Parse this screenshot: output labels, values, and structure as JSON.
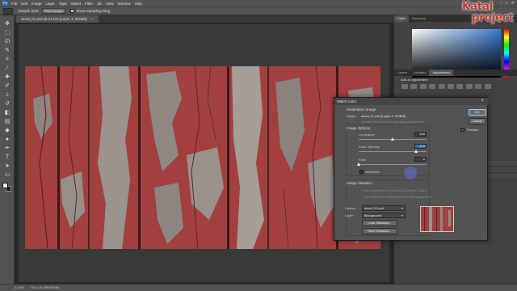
{
  "menubar": {
    "app_icon": "Ps",
    "items": [
      "File",
      "Edit",
      "Image",
      "Layer",
      "Type",
      "Select",
      "Filter",
      "3D",
      "View",
      "Window",
      "Help"
    ],
    "window_buttons": [
      "–",
      "□",
      "✕"
    ]
  },
  "options_bar": {
    "sample_size_label": "Sample Size:",
    "sample_size_value": "Point Sample",
    "show_sampling_ring": "Show Sampling Ring"
  },
  "document": {
    "tab_label": "wood_01.psd @ 21.5% (Layer 4, RGB/8)",
    "tab_close": "×"
  },
  "status_bar": {
    "zoom": "21.5%",
    "doc_info": "Doc: 15.2M/195.6M"
  },
  "color_panel": {
    "tabs": [
      "Color",
      "Swatches"
    ],
    "active_tab": "Color"
  },
  "adjustments_panel": {
    "tabs": [
      "Layers",
      "Libraries",
      "Adjustments"
    ],
    "active_tab": "Adjustments",
    "add_label": "Add an adjustment"
  },
  "match_color": {
    "title": "Match Color",
    "ok_label": "OK",
    "cancel_label": "Cancel",
    "preview_label": "Preview",
    "preview_checked": true,
    "destination_image_label": "Destination Image",
    "target_label": "Target:",
    "target_value": "wood_01.psd (Layer 4, RGB/8)",
    "ignore_selection_label": "Ignore Selection when Applying Adjustment",
    "image_options_label": "Image Options",
    "luminance_label": "Luminance",
    "luminance_value": "100",
    "luminance_level": 100,
    "luminance_max": 200,
    "color_intensity_label": "Color Intensity",
    "color_intensity_value": "170",
    "color_intensity_level": 170,
    "color_intensity_max": 200,
    "fade_label": "Fade",
    "fade_value": "0",
    "fade_level": 0,
    "fade_max": 100,
    "neutralize_label": "Neutralize",
    "image_statistics_label": "Image Statistics",
    "use_selection_source_label": "Use Selection in Source to Calculate Colors",
    "use_selection_target_label": "Use Selection in Target to Calculate Adjustment",
    "source_label": "Source:",
    "source_value": "wood_01.psd",
    "layer_label": "Layer:",
    "layer_value": "Background",
    "load_statistics_label": "Load Statistics...",
    "save_statistics_label": "Save Statistics..."
  },
  "logo": {
    "line1": "Katal",
    "line2": "project"
  },
  "colors": {
    "wood_red": "#a2403f",
    "ui_panel": "#535353",
    "accent_blue": "#2f6fb8"
  }
}
